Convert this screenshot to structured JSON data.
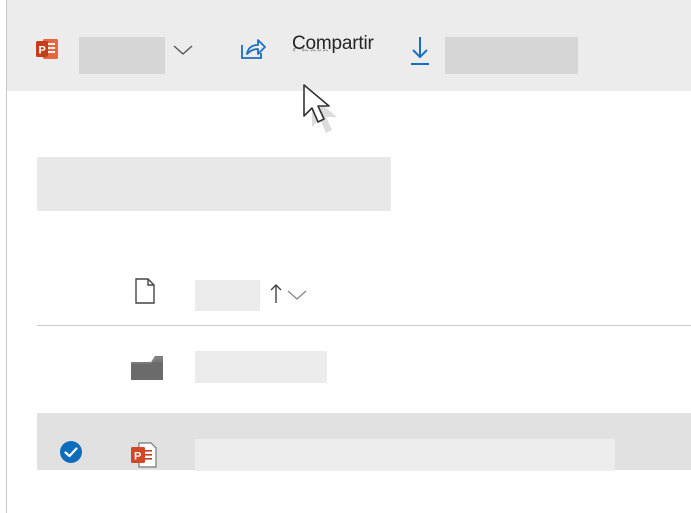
{
  "toolbar": {
    "share_label": "Compartir",
    "share_ghost": "Share",
    "icons": [
      "powerpoint-icon",
      "chevron-down-icon",
      "share-icon",
      "download-icon"
    ]
  },
  "file_list": {
    "header_icon": "file-icon",
    "sort_icons": [
      "sort-up-arrow-icon",
      "sort-chevron-down-icon"
    ],
    "rows": [
      {
        "type": "folder",
        "icon": "folder-icon",
        "selected": false
      },
      {
        "type": "powerpoint",
        "icon": "powerpoint-file-icon",
        "selected": true
      }
    ]
  },
  "colors": {
    "powerpoint": "#d24726",
    "accent_blue": "#0078d4",
    "toolbar_bg": "#ececec",
    "selected_row_bg": "#e1e1e1"
  }
}
